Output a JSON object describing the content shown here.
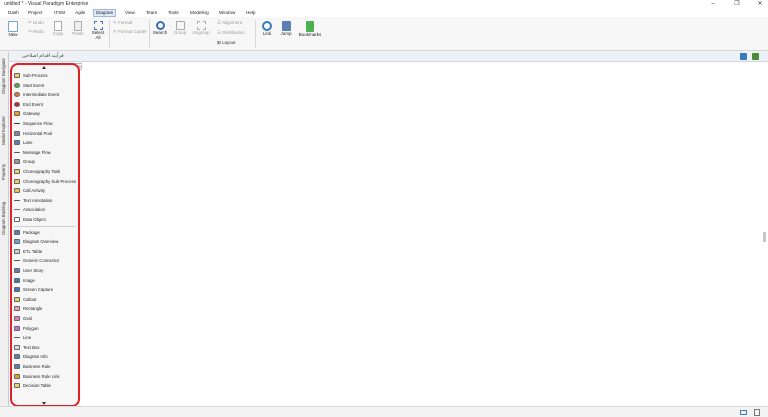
{
  "window": {
    "title": "untitled * - Visual Paradigm Enterprise",
    "controls": [
      "–",
      "❐",
      "✕"
    ]
  },
  "menubar": {
    "items": [
      "Dash",
      "Project",
      "ITSM",
      "Agile",
      "Diagram",
      "View",
      "Team",
      "Tools",
      "Modeling",
      "Window",
      "Help"
    ],
    "active": "Diagram"
  },
  "ribbon": {
    "new": "New",
    "undo": "Undo",
    "redo": "Redo",
    "copy": "Copy",
    "paste": "Paste",
    "select_all_1": "Select",
    "select_all_2": "All",
    "format": "Format",
    "format_copier": "Format Copier",
    "search": "Search",
    "group": "Group",
    "ungroup": "Ungroup",
    "alignment": "Alignment",
    "distribution": "Distribution",
    "layout": "Layout",
    "link": "Link",
    "jump": "Jump",
    "bookmarks": "Bookmarks"
  },
  "diagram_tab": "فرآیند اقدام اصلاحی",
  "breadcrumb": "<unspecified>",
  "side_tabs": [
    "Diagram Navigator",
    "Model Explorer",
    "Property",
    "Diagram Backlog"
  ],
  "palette": {
    "items": [
      {
        "label": "Sub-Process",
        "icon": "subprocess-icon",
        "color": "#f0d060",
        "arrow": true
      },
      {
        "label": "Start Event",
        "icon": "start-event-icon",
        "color": "#4caf50",
        "arrow": true
      },
      {
        "label": "Intermediate Event",
        "icon": "intermediate-event-icon",
        "color": "#e07a2a",
        "arrow": true
      },
      {
        "label": "End Event",
        "icon": "end-event-icon",
        "color": "#c62828",
        "arrow": true
      },
      {
        "label": "Gateway",
        "icon": "gateway-icon",
        "color": "#e8a317",
        "arrow": true
      },
      {
        "label": "Sequence Flow",
        "icon": "sequence-flow-icon",
        "color": "#333333",
        "arrow": true
      },
      {
        "label": "Horizontal Pool",
        "icon": "pool-icon",
        "color": "#7a8aa0",
        "arrow": true
      },
      {
        "label": "Lane",
        "icon": "lane-icon",
        "color": "#5b7fb2",
        "arrow": false
      },
      {
        "label": "Message Flow",
        "icon": "message-flow-icon",
        "color": "#555555",
        "arrow": false
      },
      {
        "label": "Group",
        "icon": "group-icon",
        "color": "#999999",
        "arrow": false
      },
      {
        "label": "Choreography Task",
        "icon": "choreography-task-icon",
        "color": "#f0d060",
        "arrow": false
      },
      {
        "label": "Choreography Sub-Process",
        "icon": "choreography-subprocess-icon",
        "color": "#f0d060",
        "arrow": true
      },
      {
        "label": "Call Activity",
        "icon": "call-activity-icon",
        "color": "#f0c040",
        "arrow": true
      },
      {
        "label": "Text Annotation",
        "icon": "text-annotation-icon",
        "color": "#555555",
        "arrow": false
      },
      {
        "label": "Association",
        "icon": "association-icon",
        "color": "#777777",
        "arrow": true
      },
      {
        "label": "Data Object",
        "icon": "data-object-icon",
        "color": "#ffffff",
        "arrow": true
      },
      {
        "label": "Package",
        "icon": "package-icon",
        "color": "#5b7fb2",
        "arrow": true
      },
      {
        "label": "Diagram Overview",
        "icon": "diagram-overview-icon",
        "color": "#6fa0d8",
        "arrow": false
      },
      {
        "label": "ETL Table",
        "icon": "etl-table-icon",
        "color": "#cccccc",
        "arrow": false
      },
      {
        "label": "Generic Connector",
        "icon": "generic-connector-icon",
        "color": "#555555",
        "arrow": false
      },
      {
        "label": "User Story",
        "icon": "user-story-icon",
        "color": "#5b7fb2",
        "arrow": false
      },
      {
        "label": "Image",
        "icon": "image-icon",
        "color": "#3a7bbf",
        "arrow": false
      },
      {
        "label": "Screen Capture",
        "icon": "screen-capture-icon",
        "color": "#3a7bbf",
        "arrow": false
      },
      {
        "label": "Callout",
        "icon": "callout-icon",
        "color": "#f0d060",
        "arrow": false
      },
      {
        "label": "Rectangle",
        "icon": "rectangle-icon",
        "color": "#f2a0b8",
        "arrow": false
      },
      {
        "label": "Oval",
        "icon": "oval-icon",
        "color": "#e080c0",
        "arrow": false
      },
      {
        "label": "Polygon",
        "icon": "polygon-icon",
        "color": "#c070e0",
        "arrow": false
      },
      {
        "label": "Line",
        "icon": "line-icon",
        "color": "#555555",
        "arrow": false
      },
      {
        "label": "Text Box",
        "icon": "text-box-icon",
        "color": "#dddddd",
        "arrow": false
      },
      {
        "label": "Diagram Info",
        "icon": "diagram-info-icon",
        "color": "#5b7fb2",
        "arrow": false
      },
      {
        "label": "Business Rule",
        "icon": "business-rule-icon",
        "color": "#5b7fb2",
        "arrow": true
      },
      {
        "label": "Business Rule Link",
        "icon": "business-rule-link-icon",
        "color": "#e8a317",
        "arrow": false
      },
      {
        "label": "Decision Table",
        "icon": "decision-table-icon",
        "color": "#f0d060",
        "arrow": false
      }
    ]
  }
}
